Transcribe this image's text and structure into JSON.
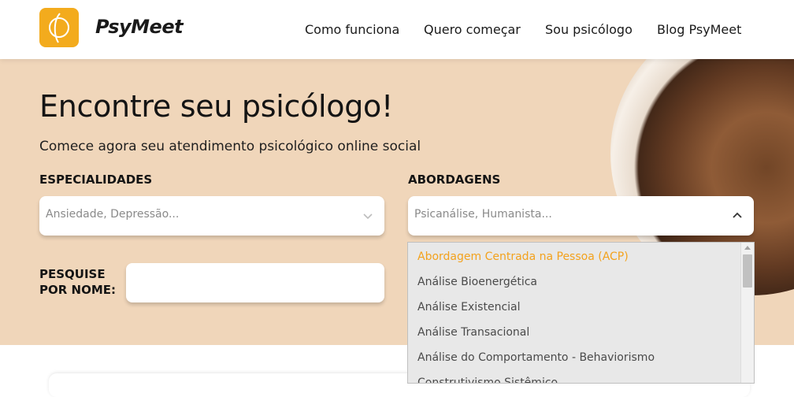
{
  "header": {
    "brand": "PsyMeet",
    "nav": [
      "Como funciona",
      "Quero começar",
      "Sou psicólogo",
      "Blog PsyMeet"
    ]
  },
  "hero": {
    "title": "Encontre seu psicólogo!",
    "subtitle": "Comece agora seu atendimento psicológico online social",
    "especialidades": {
      "label": "ESPECIALIDADES",
      "placeholder": "Ansiedade, Depressão..."
    },
    "abordagens": {
      "label": "ABORDAGENS",
      "placeholder": "Psicanálise, Humanista..."
    },
    "search": {
      "label_line1": "PESQUISE",
      "label_line2": "POR NOME:",
      "value": ""
    }
  },
  "dropdown": {
    "options": [
      "Abordagem Centrada na Pessoa (ACP)",
      "Análise Bioenergética",
      "Análise Existencial",
      "Análise Transacional",
      "Análise do Comportamento - Behaviorismo",
      "Construtivismo Sistêmico"
    ],
    "highlighted_index": 0
  },
  "colors": {
    "accent": "#f3ab1d",
    "hero_bg": "#f0d6ba",
    "highlight_text": "#f3a21d"
  }
}
